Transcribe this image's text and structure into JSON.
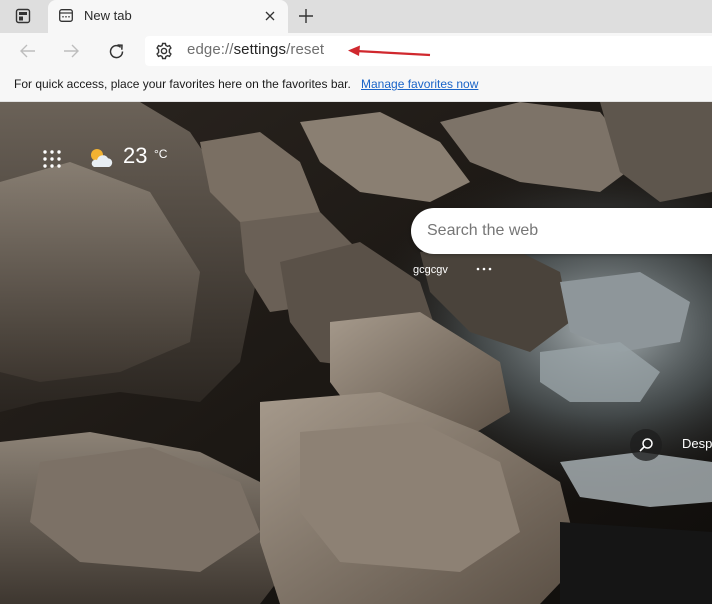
{
  "tab": {
    "title": "New tab"
  },
  "addressbar": {
    "url_host": "edge://",
    "url_rest": "settings",
    "url_path": "/reset"
  },
  "favorites_bar": {
    "message": "For quick access, place your favorites here on the favorites bar.",
    "link": "Manage favorites now"
  },
  "newtab": {
    "weather": {
      "temperature": "23",
      "unit": "°C"
    },
    "search": {
      "placeholder": "Search the web"
    },
    "quick_link": {
      "label": "gcgcgv"
    },
    "image_caption": "Desp"
  },
  "colors": {
    "annotation_arrow": "#d0282e",
    "link": "#1a64c8"
  },
  "icons": [
    "tab-actions-icon",
    "new-tab-favicon",
    "close-icon",
    "plus-icon",
    "back-arrow-icon",
    "forward-arrow-icon",
    "refresh-icon",
    "gear-icon",
    "apps-grid-icon",
    "partly-cloudy-icon",
    "more-dots-icon",
    "search-icon"
  ]
}
